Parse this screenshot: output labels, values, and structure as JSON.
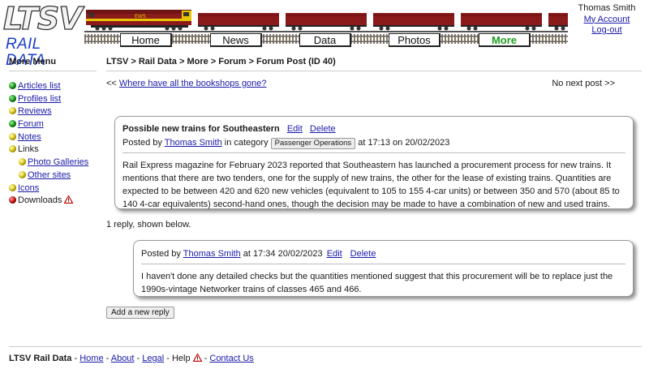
{
  "header": {
    "logo_top": "LTSV",
    "logo_bottom": "RAIL DATA",
    "locomotive_text": "EWS",
    "colors": {
      "train_maroon": "#8b1a1a",
      "train_yellow": "#e8c400",
      "logo_blue": "#1a3dcc",
      "active_tab": "#1f9e1f"
    },
    "nav": [
      {
        "label": "Home",
        "active": false
      },
      {
        "label": "News",
        "active": false
      },
      {
        "label": "Data",
        "active": false
      },
      {
        "label": "Photos",
        "active": false
      },
      {
        "label": "More",
        "active": true
      }
    ],
    "user": {
      "name": "Thomas Smith",
      "account_link": "My Account",
      "logout_link": "Log-out"
    }
  },
  "sidebar": {
    "title": "More Menu",
    "items": [
      {
        "label": "Articles list",
        "dot": "green",
        "link": true
      },
      {
        "label": "Profiles list",
        "dot": "green",
        "link": true
      },
      {
        "label": "Reviews",
        "dot": "yellow",
        "link": true
      },
      {
        "label": "Forum",
        "dot": "green",
        "link": true
      },
      {
        "label": "Notes",
        "dot": "yellow",
        "link": true
      },
      {
        "label": "Links",
        "dot": "yellow",
        "link": false
      },
      {
        "label": "Photo Galleries",
        "dot": "yellow",
        "link": true,
        "sub": true
      },
      {
        "label": "Other sites",
        "dot": "yellow",
        "link": true,
        "sub": true
      },
      {
        "label": "Icons",
        "dot": "yellow",
        "link": true
      },
      {
        "label": "Downloads",
        "dot": "red",
        "link": false,
        "warning_icon": "warning-triangle-icon"
      }
    ]
  },
  "main": {
    "breadcrumb": "LTSV > Rail Data > More > Forum > Forum Post (ID 40)",
    "prev_prefix": "<< ",
    "prev_link": "Where have all the bookshops gone?",
    "next_text": "No next post >>",
    "post": {
      "title": "Possible new trains for Southeastern",
      "edit": "Edit",
      "delete": "Delete",
      "posted_by": "Posted by ",
      "author": "Thomas Smith",
      "in_category": " in category ",
      "category": "Passenger Operations",
      "time": " at 17:13 on 20/02/2023",
      "body": "Rail Express magazine for February 2023 reported that Southeastern has launched a procurement process for new trains. It mentions that there are two tenders, one for the supply of new trains, the other for the lease of existing trains. Quantities are expected to be between 420 and 620 new vehicles (equivalent to 105 to 155 4-car units) or between 350 and 570 (about 85 to 140 4-car equivalents) second-hand ones, though the decision may be made to have a combination of new and used trains."
    },
    "reply_count": "1 reply, shown below.",
    "replies": [
      {
        "posted_by": "Posted by ",
        "author": "Thomas Smith",
        "time": " at 17:34 20/02/2023 ",
        "edit": "Edit",
        "delete": "Delete",
        "body": "I haven't done any detailed checks but the quantities mentioned suggest that this procurement will be to replace just the 1990s-vintage Networker trains of classes 465 and 466."
      }
    ],
    "add_reply": "Add a new reply"
  },
  "footer": {
    "site": "LTSV Rail Data",
    "sep": " - ",
    "home": "Home",
    "about": "About",
    "legal": "Legal",
    "help": "Help",
    "contact": "Contact Us"
  }
}
